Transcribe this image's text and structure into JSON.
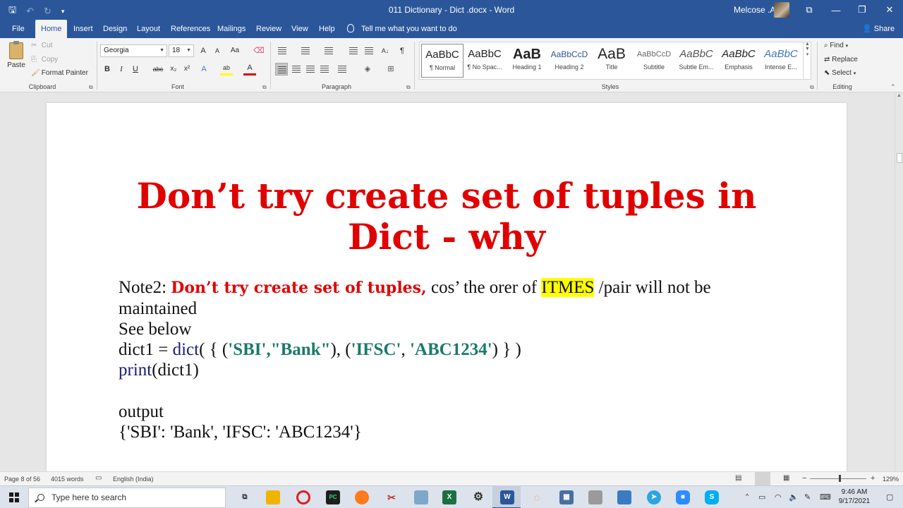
{
  "titlebar": {
    "document_title": "011 Dictionary - Dict .docx  -  Word",
    "user_name": "Melcose .A",
    "qat": {
      "save": "🖫",
      "undo": "↶",
      "redo": "↻",
      "customize": "▾"
    },
    "window_controls": {
      "ribbon_options": "⧉",
      "minimize": "—",
      "restore": "❐",
      "close": "✕"
    }
  },
  "tabs": [
    "File",
    "Home",
    "Insert",
    "Design",
    "Layout",
    "References",
    "Mailings",
    "Review",
    "View",
    "Help"
  ],
  "active_tab": "Home",
  "tell_me": "Tell me what you want to do",
  "share": "Share",
  "ribbon": {
    "clipboard": {
      "label": "Clipboard",
      "paste": "Paste",
      "cut": "Cut",
      "copy": "Copy",
      "format_painter": "Format Painter"
    },
    "font": {
      "label": "Font",
      "font_name": "Georgia",
      "font_size": "18",
      "grow": "A",
      "shrink": "A",
      "change_case": "Aa",
      "bold": "B",
      "italic": "I",
      "underline": "U",
      "strike": "abc",
      "subscript": "x₂",
      "superscript": "x²",
      "text_effects": "A",
      "highlight": "ab",
      "font_color": "A"
    },
    "paragraph": {
      "label": "Paragraph",
      "show_marks": "¶",
      "sort": "A↓"
    },
    "styles": {
      "label": "Styles",
      "items": [
        {
          "sample": "AaBbC",
          "name": "¶ Normal"
        },
        {
          "sample": "AaBbC",
          "name": "¶ No Spac..."
        },
        {
          "sample": "AaB",
          "name": "Heading 1"
        },
        {
          "sample": "AaBbCcD",
          "name": "Heading 2"
        },
        {
          "sample": "AaB",
          "name": "Title"
        },
        {
          "sample": "AaBbCcD",
          "name": "Subtitle"
        },
        {
          "sample": "AaBbC",
          "name": "Subtle Em..."
        },
        {
          "sample": "AaBbC",
          "name": "Emphasis"
        },
        {
          "sample": "AaBbC",
          "name": "Intense E..."
        }
      ]
    },
    "editing": {
      "label": "Editing",
      "find": "Find",
      "replace": "Replace",
      "select": "Select"
    }
  },
  "document": {
    "heading_line1": "Don’t try create set of tuples in",
    "heading_line2": "Dict - why",
    "note_prefix": "Note2: ",
    "note_red": "Don’t try create set of tuples,",
    "note_mid": " cos’ the orer of ",
    "note_highlight": "ITMES",
    "note_suffix": " /pair will not be",
    "note_line2": "maintained",
    "see_below": "See below",
    "code_prefix": "dict1 = ",
    "code_dict": "dict",
    "code_open": "(     { (",
    "code_sbi": "'SBI'",
    "code_comma1": ",",
    "code_bank": "\"Bank\"",
    "code_mid": "), (",
    "code_ifsc": "'IFSC'",
    "code_comma2": ", ",
    "code_abc": "'ABC1234'",
    "code_close": ") }         )",
    "print_fn": "print",
    "print_arg": "(dict1)",
    "output_label": "output",
    "output_value": "{'SBI': 'Bank', 'IFSC': 'ABC1234'}"
  },
  "statusbar": {
    "page": "Page 8 of 56",
    "words": "4015 words",
    "language": "English (India)",
    "zoom": "129%",
    "zoom_out": "−",
    "zoom_in": "+"
  },
  "taskbar": {
    "search_placeholder": "Type here to search",
    "time": "9:46 AM",
    "date": "9/17/2021"
  }
}
